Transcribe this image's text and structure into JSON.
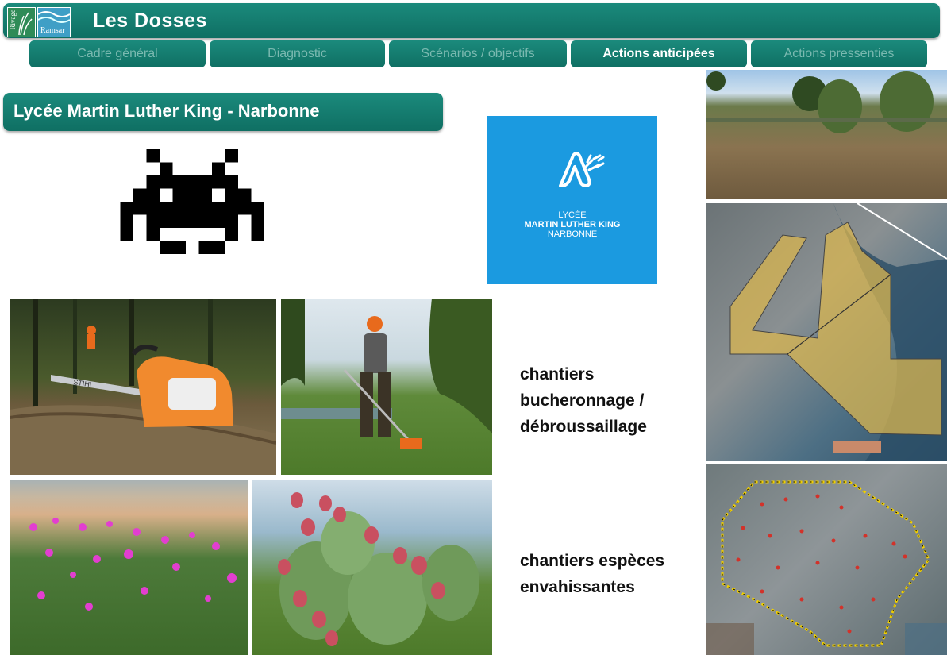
{
  "header": {
    "title": "Les Dosses",
    "logo_rivage": "Rivage",
    "logo_ramsar": "Ramsar"
  },
  "nav": {
    "tabs": [
      {
        "label": "Cadre  général",
        "active": false
      },
      {
        "label": "Diagnostic",
        "active": false
      },
      {
        "label": "Scénarios  / objectifs",
        "active": false
      },
      {
        "label": "Actions  anticipées",
        "active": true
      },
      {
        "label": "Actions  pressenties",
        "active": false
      }
    ]
  },
  "section": {
    "title": "Lycée Martin Luther King - Narbonne"
  },
  "school_logo": {
    "line1": "LYCÉE",
    "line2": "MARTIN LUTHER KING",
    "line3": "NARBONNE",
    "bg_color": "#1b9ae0"
  },
  "captions": {
    "chantiers_bucheronnage": [
      "chantiers",
      "bucheronnage /",
      "débroussaillage"
    ],
    "chantiers_especes": [
      "chantiers espèces",
      "envahissantes"
    ]
  },
  "photos": {
    "chainsaw_brand": "STIHL"
  },
  "colors": {
    "teal": "#157d70",
    "inactive_tab_text": "#7ab9b0"
  }
}
